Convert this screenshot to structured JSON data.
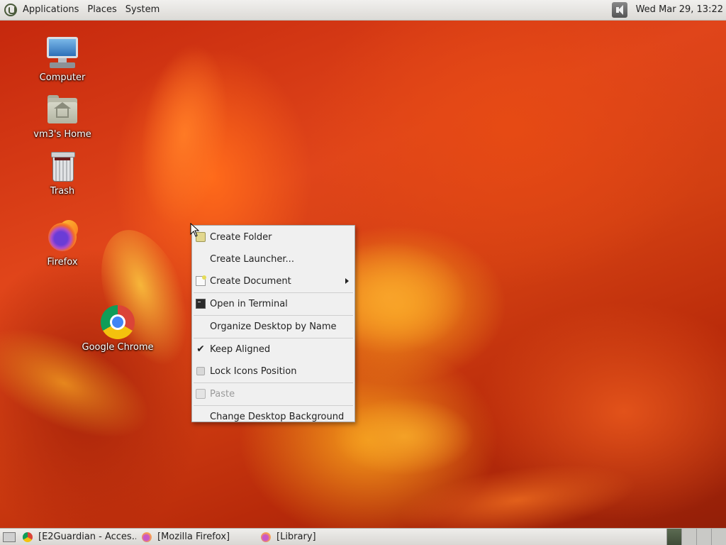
{
  "top_panel": {
    "menus": [
      "Applications",
      "Places",
      "System"
    ],
    "clock": "Wed Mar 29, 13:22"
  },
  "desktop_icons": [
    {
      "label": "Computer",
      "icon": "computer-icon"
    },
    {
      "label": "vm3's Home",
      "icon": "home-folder-icon"
    },
    {
      "label": "Trash",
      "icon": "trash-icon"
    },
    {
      "label": "Firefox",
      "icon": "firefox-icon"
    },
    {
      "label": "Google Chrome",
      "icon": "chrome-icon"
    }
  ],
  "context_menu": {
    "items": [
      {
        "label": "Create Folder",
        "icon": "folder-icon",
        "disabled": false
      },
      {
        "label": "Create Launcher...",
        "icon": "",
        "disabled": false
      },
      {
        "label": "Create Document",
        "icon": "document-icon",
        "submenu": true,
        "disabled": false
      },
      {
        "label": "Open in Terminal",
        "icon": "terminal-icon",
        "disabled": false
      },
      {
        "label": "Organize Desktop by Name",
        "icon": "",
        "disabled": false
      },
      {
        "label": "Keep Aligned",
        "icon": "checkmark-icon",
        "checked": true,
        "disabled": false
      },
      {
        "label": "Lock Icons Position",
        "icon": "checkbox-icon",
        "checked": false,
        "disabled": false
      },
      {
        "label": "Paste",
        "icon": "paste-icon",
        "disabled": true
      },
      {
        "label": "Change Desktop Background",
        "icon": "",
        "disabled": false
      }
    ]
  },
  "taskbar": {
    "tasks": [
      {
        "label": "[E2Guardian - Acces...",
        "icon": "chrome-icon"
      },
      {
        "label": "[Mozilla Firefox]",
        "icon": "firefox-icon"
      },
      {
        "label": "[Library]",
        "icon": "firefox-icon"
      }
    ],
    "workspaces": 4,
    "active_workspace": 1
  }
}
